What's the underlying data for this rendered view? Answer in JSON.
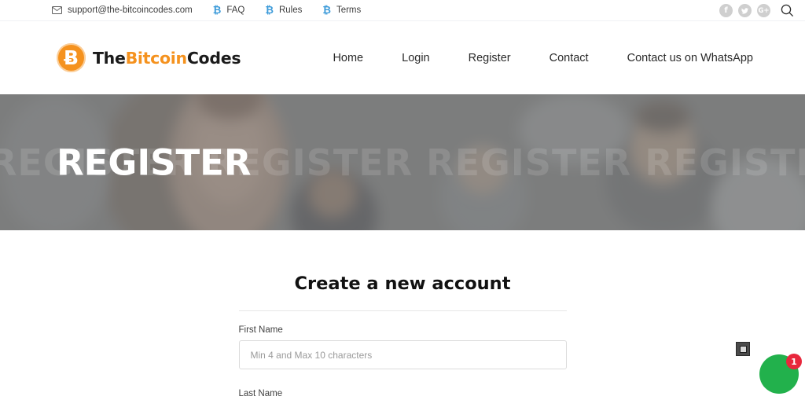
{
  "topbar": {
    "email": "support@the-bitcoincodes.com",
    "email_icon": "mail-icon",
    "links": [
      {
        "label": "FAQ",
        "icon": "bitcoin-icon",
        "glyph": "₿"
      },
      {
        "label": "Rules",
        "icon": "bitcoin-icon",
        "glyph": "₿"
      },
      {
        "label": "Terms",
        "icon": "bitcoin-icon",
        "glyph": "₿"
      }
    ],
    "social": [
      {
        "name": "facebook-icon",
        "glyph": "f"
      },
      {
        "name": "twitter-icon",
        "glyph": "ᴠ"
      },
      {
        "name": "google-plus-icon",
        "glyph": "G+"
      }
    ],
    "search_icon": "search-icon",
    "bitcoin_link_color": "#3b9ad9",
    "social_bg_color": "#cfcfcf"
  },
  "header": {
    "logo": {
      "icon": "bitcoin-logo-icon",
      "glyph": "Ƀ",
      "part1": "The",
      "part2": "Bitcoin",
      "part3": "Codes",
      "accent_color": "#f5921e"
    },
    "nav": [
      {
        "label": "Home"
      },
      {
        "label": "Login"
      },
      {
        "label": "Register"
      },
      {
        "label": "Contact"
      },
      {
        "label": "Contact us on WhatsApp"
      }
    ]
  },
  "hero": {
    "title": "REGISTER",
    "ghost_text": "REGISTER REGISTER REGISTER REGISTER R",
    "overlay_color": "#7d7e7e"
  },
  "form": {
    "title": "Create a new account",
    "fields": [
      {
        "label": "First Name",
        "placeholder": "Min 4 and Max 10 characters",
        "value": ""
      },
      {
        "label": "Last Name",
        "placeholder": "",
        "value": ""
      }
    ]
  },
  "widgets": {
    "broken_image_icon": "broken-image-icon",
    "chat_icon": "whatsapp-chat-icon",
    "chat_badge_count": "1",
    "chat_color": "#22b14c",
    "badge_color": "#e8273c"
  }
}
